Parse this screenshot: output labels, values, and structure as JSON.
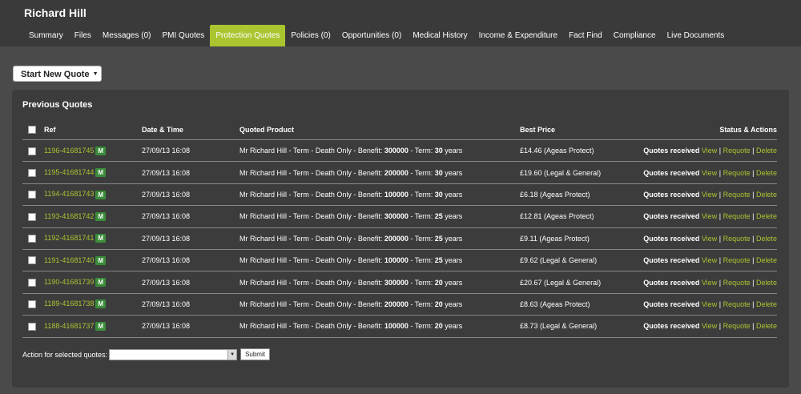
{
  "client": {
    "name": "Richard Hill"
  },
  "tabs": [
    {
      "label": "Summary"
    },
    {
      "label": "Files"
    },
    {
      "label": "Messages (0)"
    },
    {
      "label": "PMI Quotes"
    },
    {
      "label": "Protection Quotes"
    },
    {
      "label": "Policies (0)"
    },
    {
      "label": "Opportunities (0)"
    },
    {
      "label": "Medical History"
    },
    {
      "label": "Income & Expenditure"
    },
    {
      "label": "Fact Find"
    },
    {
      "label": "Compliance"
    },
    {
      "label": "Live Documents"
    }
  ],
  "active_tab": "Protection Quotes",
  "start_button": {
    "label": "Start New Quote"
  },
  "panel": {
    "title": "Previous Quotes"
  },
  "columns": {
    "ref": "Ref",
    "datetime": "Date & Time",
    "product": "Quoted Product",
    "price": "Best Price",
    "status": "Status & Actions"
  },
  "rows": [
    {
      "ref": "1196-41681745",
      "badge": "M",
      "datetime": "27/09/13 16:08",
      "product_prefix": "Mr Richard Hill - Term - Death Only - Benefit: ",
      "benefit": "300000",
      "term_label": " - Term: ",
      "term": "30",
      "term_suffix": " years",
      "price": "£14.46 (Ageas Protect)",
      "status": "Quotes received",
      "view": "View",
      "requote": "Requote",
      "delete": "Delete"
    },
    {
      "ref": "1195-41681744",
      "badge": "M",
      "datetime": "27/09/13 16:08",
      "product_prefix": "Mr Richard Hill - Term - Death Only - Benefit: ",
      "benefit": "200000",
      "term_label": " - Term: ",
      "term": "30",
      "term_suffix": " years",
      "price": "£19.60 (Legal & General)",
      "status": "Quotes received",
      "view": "View",
      "requote": "Requote",
      "delete": "Delete"
    },
    {
      "ref": "1194-41681743",
      "badge": "M",
      "datetime": "27/09/13 16:08",
      "product_prefix": "Mr Richard Hill - Term - Death Only - Benefit: ",
      "benefit": "100000",
      "term_label": " - Term: ",
      "term": "30",
      "term_suffix": " years",
      "price": "£6.18 (Ageas Protect)",
      "status": "Quotes received",
      "view": "View",
      "requote": "Requote",
      "delete": "Delete"
    },
    {
      "ref": "1193-41681742",
      "badge": "M",
      "datetime": "27/09/13 16:08",
      "product_prefix": "Mr Richard Hill - Term - Death Only - Benefit: ",
      "benefit": "300000",
      "term_label": " - Term: ",
      "term": "25",
      "term_suffix": " years",
      "price": "£12.81 (Ageas Protect)",
      "status": "Quotes received",
      "view": "View",
      "requote": "Requote",
      "delete": "Delete"
    },
    {
      "ref": "1192-41681741",
      "badge": "M",
      "datetime": "27/09/13 16:08",
      "product_prefix": "Mr Richard Hill - Term - Death Only - Benefit: ",
      "benefit": "200000",
      "term_label": " - Term: ",
      "term": "25",
      "term_suffix": " years",
      "price": "£9.11 (Ageas Protect)",
      "status": "Quotes received",
      "view": "View",
      "requote": "Requote",
      "delete": "Delete"
    },
    {
      "ref": "1191-41681740",
      "badge": "M",
      "datetime": "27/09/13 16:08",
      "product_prefix": "Mr Richard Hill - Term - Death Only - Benefit: ",
      "benefit": "100000",
      "term_label": " - Term: ",
      "term": "25",
      "term_suffix": " years",
      "price": "£9.62 (Legal & General)",
      "status": "Quotes received",
      "view": "View",
      "requote": "Requote",
      "delete": "Delete"
    },
    {
      "ref": "1190-41681739",
      "badge": "M",
      "datetime": "27/09/13 16:08",
      "product_prefix": "Mr Richard Hill - Term - Death Only - Benefit: ",
      "benefit": "300000",
      "term_label": " - Term: ",
      "term": "20",
      "term_suffix": " years",
      "price": "£20.67 (Legal & General)",
      "status": "Quotes received",
      "view": "View",
      "requote": "Requote",
      "delete": "Delete"
    },
    {
      "ref": "1189-41681738",
      "badge": "M",
      "datetime": "27/09/13 16:08",
      "product_prefix": "Mr Richard Hill - Term - Death Only - Benefit: ",
      "benefit": "200000",
      "term_label": " - Term: ",
      "term": "20",
      "term_suffix": " years",
      "price": "£8.63 (Ageas Protect)",
      "status": "Quotes received",
      "view": "View",
      "requote": "Requote",
      "delete": "Delete"
    },
    {
      "ref": "1188-41681737",
      "badge": "M",
      "datetime": "27/09/13 16:08",
      "product_prefix": "Mr Richard Hill - Term - Death Only - Benefit: ",
      "benefit": "100000",
      "term_label": " - Term: ",
      "term": "20",
      "term_suffix": " years",
      "price": "£8.73 (Legal & General)",
      "status": "Quotes received",
      "view": "View",
      "requote": "Requote",
      "delete": "Delete"
    }
  ],
  "action": {
    "label": "Action for selected quotes:",
    "selected_value": "",
    "submit_label": "Submit"
  },
  "colors": {
    "accent": "#a9c631",
    "badge": "#3a8c3a",
    "header_bg": "#3a3a3a",
    "panel_bg": "#3c3c3c"
  }
}
